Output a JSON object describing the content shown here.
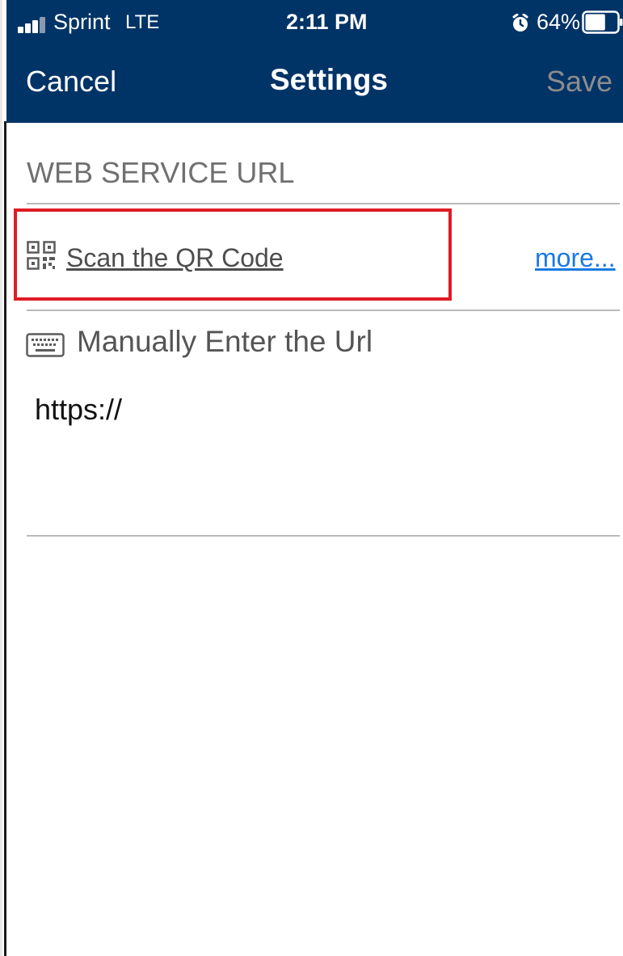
{
  "status_bar": {
    "carrier": "Sprint",
    "network": "LTE",
    "time": "2:11 PM",
    "battery_percent": "64%",
    "battery_level": 0.64,
    "icons": [
      "signal-icon",
      "alarm-icon",
      "battery-icon"
    ]
  },
  "nav": {
    "cancel_label": "Cancel",
    "title": "Settings",
    "save_label": "Save"
  },
  "section": {
    "header": "WEB SERVICE URL"
  },
  "scan": {
    "label": "Scan the QR Code",
    "more_label": "more..."
  },
  "manual": {
    "label": "Manually Enter the Url",
    "url_value": "https://"
  },
  "colors": {
    "nav_background": "#003366",
    "save_disabled": "#8c8c8c",
    "link": "#1a7ae2",
    "highlight": "#e01b24"
  }
}
